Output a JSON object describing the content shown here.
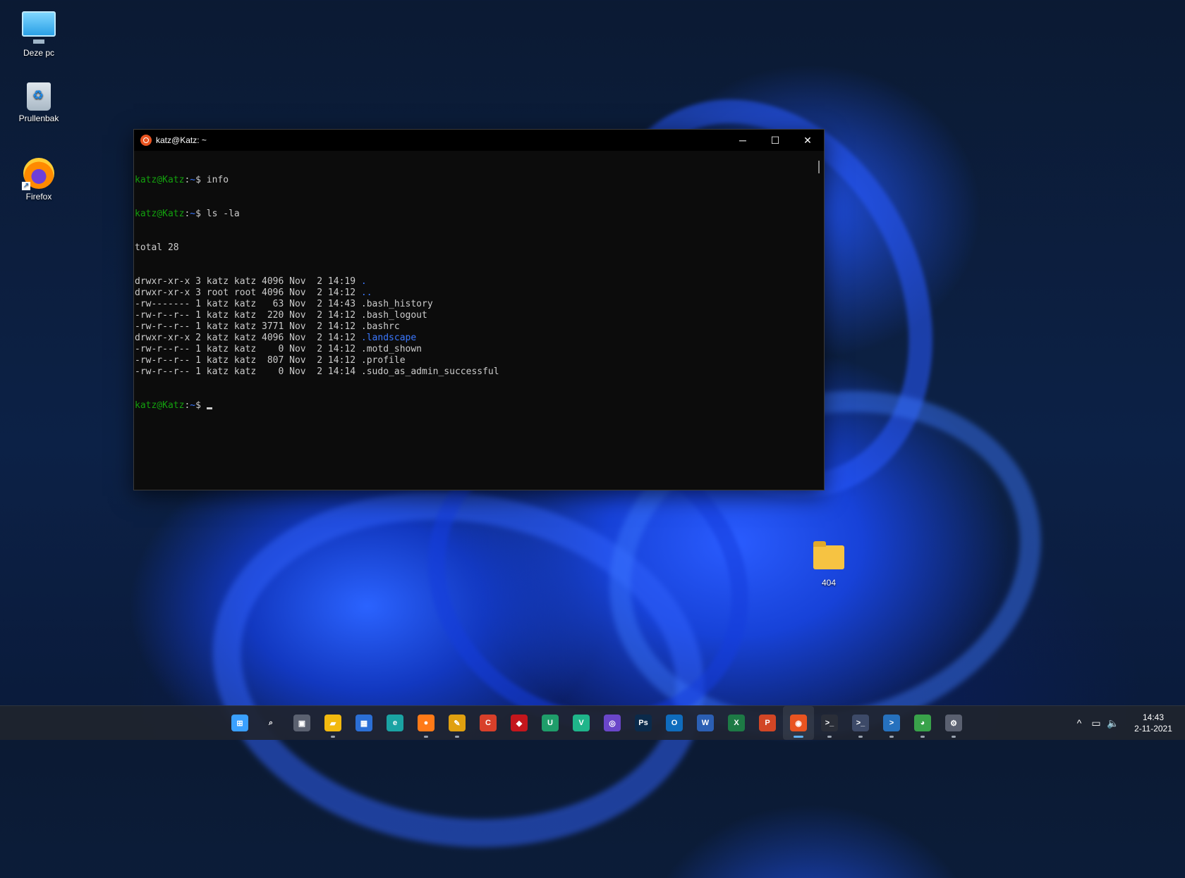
{
  "desktop": {
    "icons": [
      {
        "label": "Deze pc",
        "icon": "computer-icon"
      },
      {
        "label": "Prullenbak",
        "icon": "recycle-bin-icon"
      },
      {
        "label": "Firefox",
        "icon": "firefox-icon"
      },
      {
        "label": "404",
        "icon": "folder-icon"
      }
    ]
  },
  "window": {
    "title": "katz@Katz: ~",
    "icon": "ubuntu-icon",
    "controls": {
      "minimize": "─",
      "maximize": "☐",
      "close": "✕"
    }
  },
  "terminal": {
    "prompt_user": "katz@Katz",
    "prompt_path": "~",
    "commands": [
      "info",
      "ls -la"
    ],
    "total": "total 28",
    "listing": [
      {
        "meta": "drwxr-xr-x 3 katz katz 4096 Nov  2 14:19 ",
        "name": ".",
        "dir": true
      },
      {
        "meta": "drwxr-xr-x 3 root root 4096 Nov  2 14:12 ",
        "name": "..",
        "dir": true
      },
      {
        "meta": "-rw------- 1 katz katz   63 Nov  2 14:43 ",
        "name": ".bash_history",
        "dir": false
      },
      {
        "meta": "-rw-r--r-- 1 katz katz  220 Nov  2 14:12 ",
        "name": ".bash_logout",
        "dir": false
      },
      {
        "meta": "-rw-r--r-- 1 katz katz 3771 Nov  2 14:12 ",
        "name": ".bashrc",
        "dir": false
      },
      {
        "meta": "drwxr-xr-x 2 katz katz 4096 Nov  2 14:12 ",
        "name": ".landscape",
        "dir": true
      },
      {
        "meta": "-rw-r--r-- 1 katz katz    0 Nov  2 14:12 ",
        "name": ".motd_shown",
        "dir": false
      },
      {
        "meta": "-rw-r--r-- 1 katz katz  807 Nov  2 14:12 ",
        "name": ".profile",
        "dir": false
      },
      {
        "meta": "-rw-r--r-- 1 katz katz    0 Nov  2 14:14 ",
        "name": ".sudo_as_admin_successful",
        "dir": false
      }
    ],
    "colors": {
      "user": "#13a10e",
      "path": "#3b78ff",
      "dir": "#3b78ff"
    }
  },
  "taskbar": {
    "apps": [
      {
        "name": "start-button",
        "glyph": "⊞",
        "color": "#3aa0ff",
        "running": false
      },
      {
        "name": "search-icon",
        "glyph": "⌕",
        "color": "transparent",
        "running": false
      },
      {
        "name": "task-view-icon",
        "glyph": "▣",
        "color": "#5b6170",
        "running": false
      },
      {
        "name": "file-explorer-icon",
        "glyph": "▰",
        "color": "#f2b90f",
        "running": true
      },
      {
        "name": "microsoft-store-icon",
        "glyph": "▦",
        "color": "#2b6fd6",
        "running": false
      },
      {
        "name": "edge-icon",
        "glyph": "e",
        "color": "#1aa3a3",
        "running": false
      },
      {
        "name": "firefox-icon",
        "glyph": "●",
        "color": "#ff7a18",
        "running": true
      },
      {
        "name": "notes-icon",
        "glyph": "✎",
        "color": "#e0a010",
        "running": true
      },
      {
        "name": "ccleaner-icon",
        "glyph": "C",
        "color": "#d8402a",
        "running": false
      },
      {
        "name": "shield-app-icon",
        "glyph": "◆",
        "color": "#c4161c",
        "running": false
      },
      {
        "name": "u-app-icon",
        "glyph": "U",
        "color": "#1f9d6a",
        "running": false
      },
      {
        "name": "v-app-icon",
        "glyph": "V",
        "color": "#1fb58a",
        "running": false
      },
      {
        "name": "purple-app-icon",
        "glyph": "◎",
        "color": "#6a46c9",
        "running": false
      },
      {
        "name": "photoshop-icon",
        "glyph": "Ps",
        "color": "#0b2a4a",
        "running": false
      },
      {
        "name": "outlook-icon",
        "glyph": "O",
        "color": "#0f6cbd",
        "running": false
      },
      {
        "name": "word-icon",
        "glyph": "W",
        "color": "#2b5fb4",
        "running": false
      },
      {
        "name": "excel-icon",
        "glyph": "X",
        "color": "#1d7a45",
        "running": false
      },
      {
        "name": "powerpoint-icon",
        "glyph": "P",
        "color": "#d24625",
        "running": false
      },
      {
        "name": "ubuntu-icon",
        "glyph": "◉",
        "color": "#e95420",
        "running": true,
        "active": true
      },
      {
        "name": "terminal-icon",
        "glyph": ">_",
        "color": "#2a2e38",
        "running": true
      },
      {
        "name": "powershell-icon",
        "glyph": ">_",
        "color": "#3d4a68",
        "running": true
      },
      {
        "name": "powershell-blue-icon",
        "glyph": ">",
        "color": "#2671be",
        "running": true
      },
      {
        "name": "globe-app-icon",
        "glyph": "◕",
        "color": "#39a24a",
        "running": true
      },
      {
        "name": "settings-icon",
        "glyph": "⚙",
        "color": "#5a6070",
        "running": true
      }
    ],
    "tray": {
      "chevron": "^",
      "network": "▭",
      "volume": "🔈",
      "time": "14:43",
      "date": "2-11-2021"
    }
  }
}
